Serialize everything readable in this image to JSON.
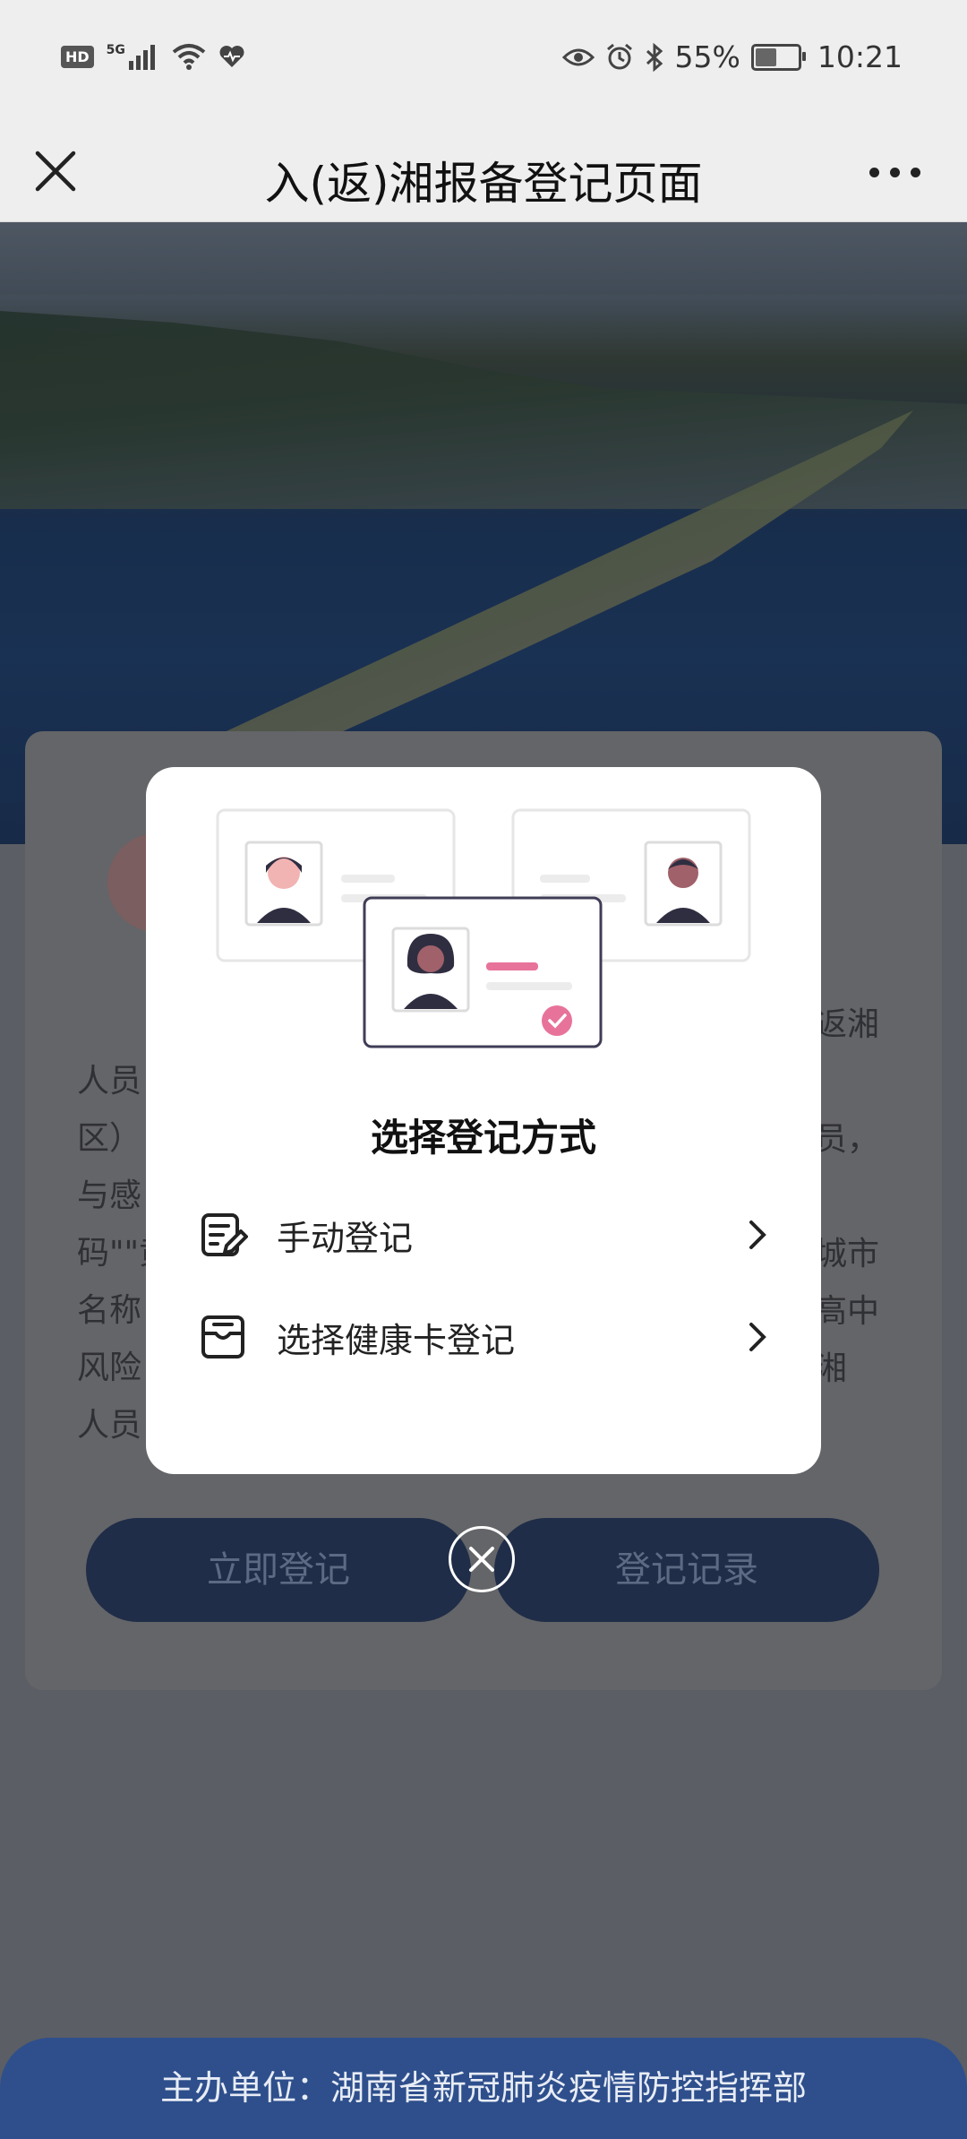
{
  "status_bar": {
    "left_badges": [
      "HD",
      "5G"
    ],
    "battery_percent": "55%",
    "battery_level": 0.55,
    "time": "10:21",
    "icons": [
      "signal-icon",
      "wifi-icon",
      "heart-icon",
      "eye-icon",
      "alarm-icon",
      "bluetooth-icon",
      "battery-icon"
    ]
  },
  "nav": {
    "title": "入(返)湘报备登记页面"
  },
  "background": {
    "text_left": [
      "人员",
      "区）",
      "与感",
      "码\"\"黄",
      "名称",
      "风险",
      "人员"
    ],
    "text_right": [
      "返湘",
      "员，",
      "城市",
      "高中",
      "湘"
    ],
    "buttons": {
      "register_now": "立即登记",
      "register_records": "登记记录"
    }
  },
  "modal": {
    "title": "选择登记方式",
    "options": [
      {
        "label": "手动登记",
        "icon": "edit-document-icon"
      },
      {
        "label": "选择健康卡登记",
        "icon": "health-card-icon"
      }
    ]
  },
  "footer": {
    "text": "主办单位：湖南省新冠肺炎疫情防控指挥部"
  },
  "colors": {
    "accent_pink": "#e8739a",
    "footer_blue": "#2e4f8c",
    "overlay_dim": "#5b5e64"
  }
}
